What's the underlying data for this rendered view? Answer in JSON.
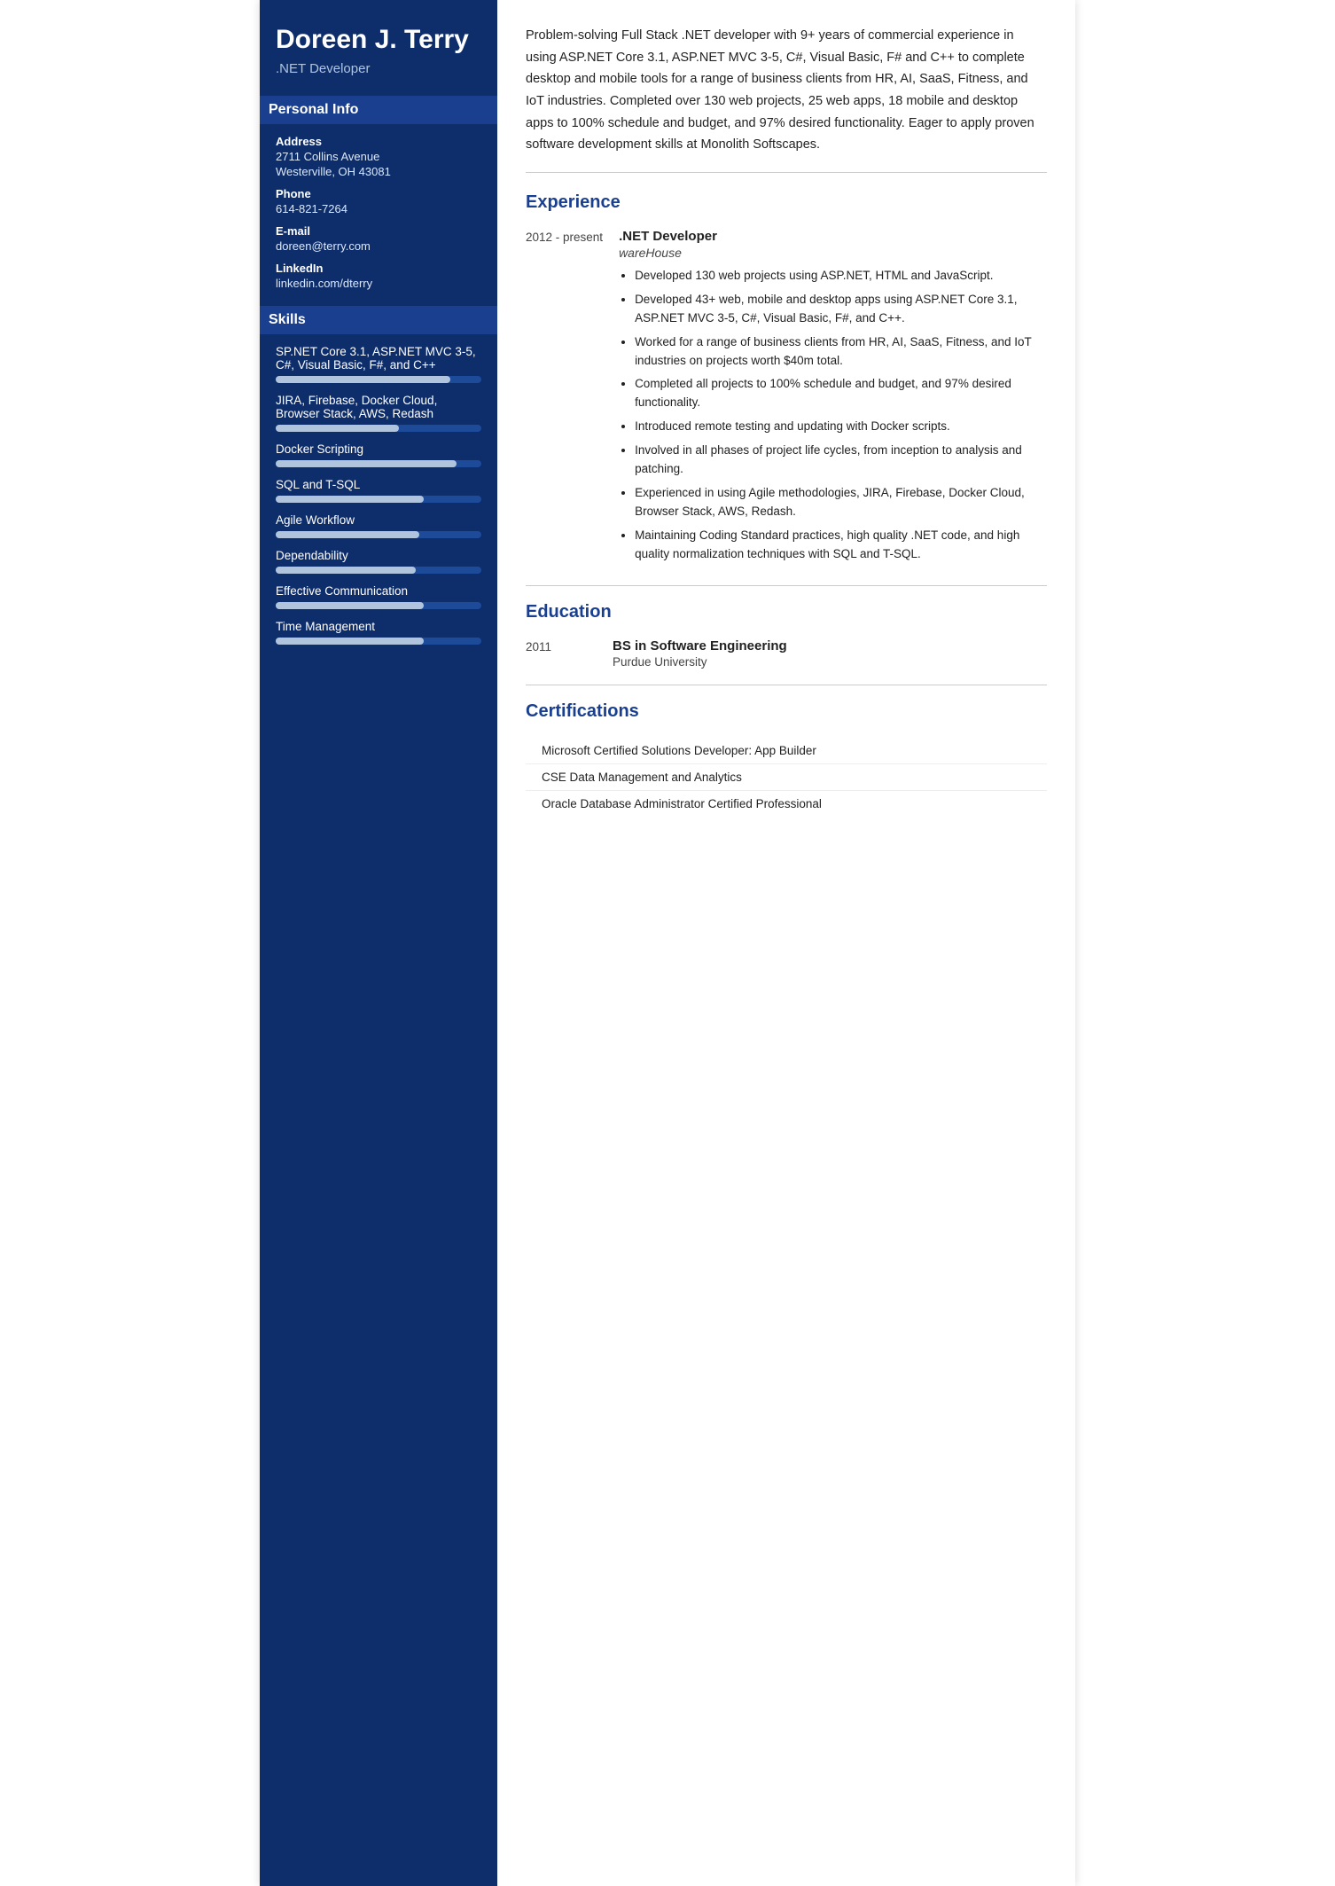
{
  "sidebar": {
    "name": "Doreen J. Terry",
    "title": ".NET Developer",
    "personal_info_header": "Personal Info",
    "address_label": "Address",
    "address_line1": "2711 Collins Avenue",
    "address_line2": "Westerville, OH 43081",
    "phone_label": "Phone",
    "phone": "614-821-7264",
    "email_label": "E-mail",
    "email": "doreen@terry.com",
    "linkedin_label": "LinkedIn",
    "linkedin": "linkedin.com/dterry",
    "skills_header": "Skills",
    "skills": [
      {
        "name": "SP.NET Core 3.1, ASP.NET MVC 3-5, C#, Visual Basic, F#, and C++",
        "fill": 85
      },
      {
        "name": "JIRA, Firebase, Docker Cloud, Browser Stack, AWS, Redash",
        "fill": 60
      },
      {
        "name": "Docker Scripting",
        "fill": 88
      },
      {
        "name": "SQL and T-SQL",
        "fill": 72
      },
      {
        "name": "Agile Workflow",
        "fill": 70
      },
      {
        "name": "Dependability",
        "fill": 68
      },
      {
        "name": "Effective Communication",
        "fill": 72
      },
      {
        "name": "Time Management",
        "fill": 72
      }
    ]
  },
  "main": {
    "summary": "Problem-solving Full Stack .NET developer with 9+ years of commercial experience in using ASP.NET Core 3.1, ASP.NET MVC 3-5, C#, Visual Basic, F# and C++ to complete desktop and mobile tools for a range of business clients from HR, AI, SaaS, Fitness, and IoT industries. Completed over 130 web projects, 25 web apps, 18 mobile and desktop apps to 100% schedule and budget, and 97% desired functionality. Eager to apply proven software development skills at Monolith Softscapes.",
    "experience_header": "Experience",
    "experience": [
      {
        "date": "2012 - present",
        "job_title": ".NET Developer",
        "company": "wareHouse",
        "bullets": [
          "Developed 130 web projects using ASP.NET, HTML and JavaScript.",
          "Developed 43+ web, mobile and desktop apps using ASP.NET Core 3.1, ASP.NET MVC 3-5, C#, Visual Basic, F#, and C++.",
          "Worked for a range of business clients from HR, AI, SaaS, Fitness, and IoT industries on projects worth $40m total.",
          "Completed all projects to 100% schedule and budget, and 97% desired functionality.",
          "Introduced remote testing and updating with Docker scripts.",
          "Involved in all phases of project life cycles, from inception to analysis and patching.",
          "Experienced in using Agile methodologies, JIRA, Firebase, Docker Cloud, Browser Stack, AWS, Redash.",
          "Maintaining Coding Standard practices, high quality .NET code, and high quality normalization techniques with SQL and T-SQL."
        ]
      }
    ],
    "education_header": "Education",
    "education": [
      {
        "year": "2011",
        "degree": "BS in Software Engineering",
        "school": "Purdue University"
      }
    ],
    "certifications_header": "Certifications",
    "certifications": [
      "Microsoft Certified Solutions Developer: App Builder",
      "CSE Data Management and Analytics",
      "Oracle Database Administrator Certified Professional"
    ]
  }
}
